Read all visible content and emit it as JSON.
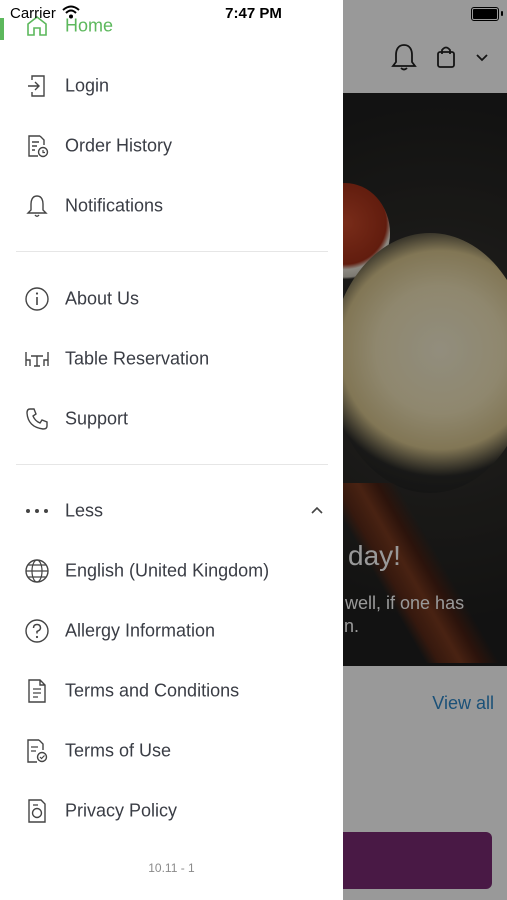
{
  "status_bar": {
    "carrier": "Carrier",
    "time": "7:47 PM"
  },
  "background": {
    "hero_title": "day!",
    "hero_desc": "p well, if one has\nt in.",
    "view_all": "View all"
  },
  "menu": {
    "items_group1": [
      {
        "label": "Home",
        "icon": "home-icon",
        "active": true
      },
      {
        "label": "Login",
        "icon": "login-icon"
      },
      {
        "label": "Order History",
        "icon": "order-history-icon"
      },
      {
        "label": "Notifications",
        "icon": "bell-icon"
      }
    ],
    "items_group2": [
      {
        "label": "About Us",
        "icon": "info-icon"
      },
      {
        "label": "Table Reservation",
        "icon": "table-icon"
      },
      {
        "label": "Support",
        "icon": "phone-icon"
      }
    ],
    "less_toggle": {
      "label": "Less",
      "icon": "more-dots-icon",
      "chevron": "chevron-up-icon"
    },
    "items_group3": [
      {
        "label": "English (United Kingdom)",
        "icon": "globe-icon"
      },
      {
        "label": "Allergy Information",
        "icon": "question-icon"
      },
      {
        "label": "Terms and Conditions",
        "icon": "document-icon"
      },
      {
        "label": "Terms of Use",
        "icon": "document-check-icon"
      },
      {
        "label": "Privacy Policy",
        "icon": "privacy-icon"
      }
    ],
    "version": "10.11 - 1"
  },
  "colors": {
    "accent_green": "#5cb85c",
    "link_blue": "#2d87c9",
    "cta_purple": "#7b2a73",
    "text": "#3a3d45"
  }
}
